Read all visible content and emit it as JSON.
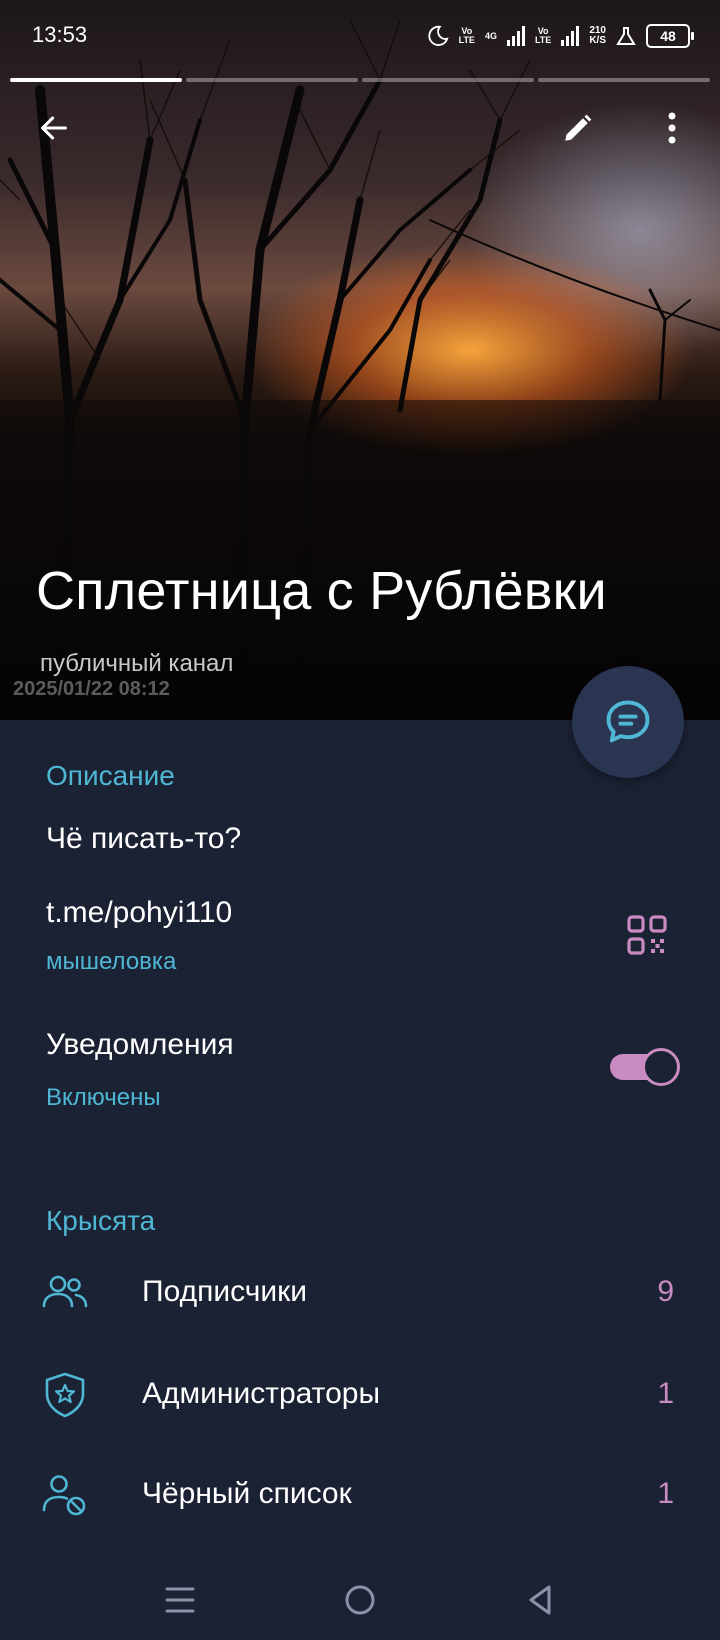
{
  "status_bar": {
    "time": "13:53",
    "net1": "Vo\nLTE",
    "net2": "4G",
    "net3": "Vo\nLTE",
    "speed": "210\nK/S",
    "battery": "48"
  },
  "header": {
    "title": "Сплетница с Рублёвки",
    "subtitle": "публичный канал",
    "photo_stamp": "2025/01/22 08:12",
    "story_segments": 4,
    "active_segment": 1
  },
  "info": {
    "description_label": "Описание",
    "description_text": "Чё писать-то?",
    "link": "t.me/pohyi110",
    "link_caption": "мышеловка",
    "notifications_label": "Уведомления",
    "notifications_state": "Включены",
    "notifications_on": true
  },
  "members": {
    "section_label": "Крысята",
    "rows": [
      {
        "label": "Подписчики",
        "count": "9",
        "icon": "users-icon"
      },
      {
        "label": "Администраторы",
        "count": "1",
        "icon": "shield-star-icon"
      },
      {
        "label": "Чёрный список",
        "count": "1",
        "icon": "user-blocked-icon"
      }
    ]
  },
  "colors": {
    "background": "#1b2233",
    "accent": "#4fb6d4",
    "pink": "#c98bc1",
    "fab": "#2a3552"
  }
}
